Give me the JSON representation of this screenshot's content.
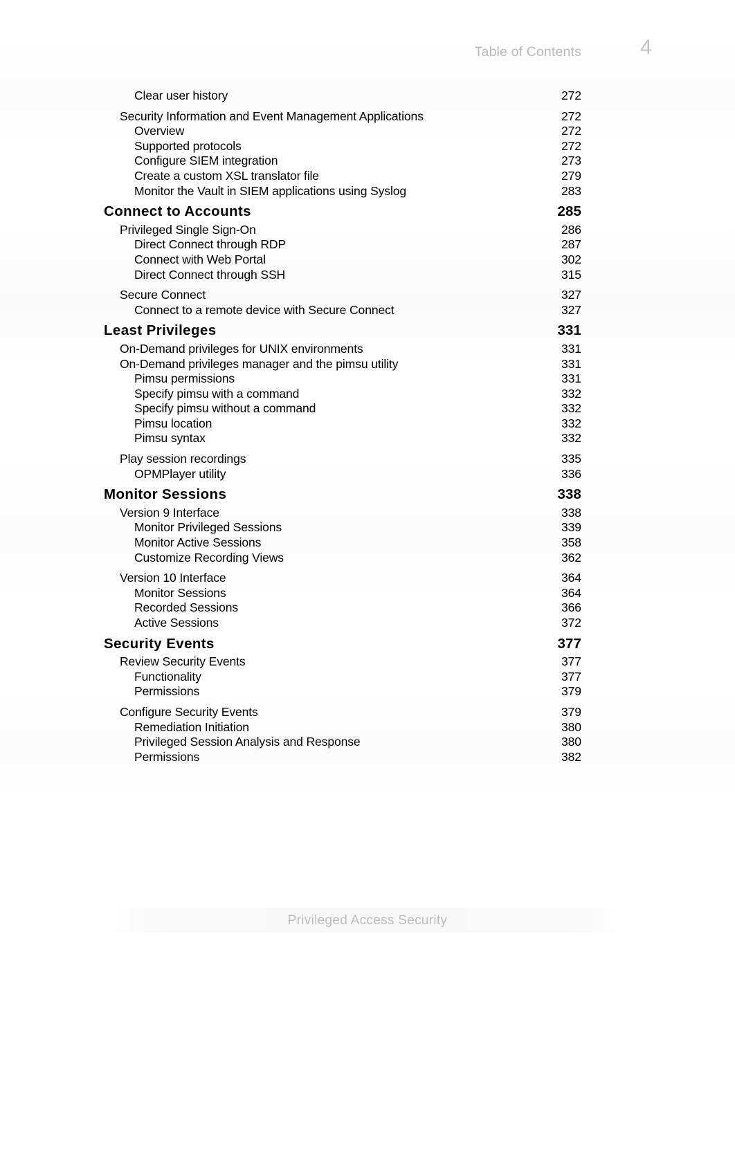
{
  "header": {
    "label": "Table of Contents",
    "page_number": "4"
  },
  "footer": {
    "text": "Privileged Access Security"
  },
  "toc": {
    "entries": [
      {
        "level": 2,
        "title": "Clear user history",
        "page": "272"
      },
      {
        "level": 1,
        "title": "Security Information and Event Management Applications",
        "page": "272"
      },
      {
        "level": 2,
        "title": "Overview",
        "page": "272"
      },
      {
        "level": 2,
        "title": "Supported protocols",
        "page": "272"
      },
      {
        "level": 2,
        "title": "Configure SIEM integration",
        "page": "273"
      },
      {
        "level": 2,
        "title": "Create a custom XSL translator file",
        "page": "279"
      },
      {
        "level": 2,
        "title": "Monitor the Vault in SIEM applications using Syslog",
        "page": "283"
      },
      {
        "level": 0,
        "title": "Connect to Accounts",
        "page": "285"
      },
      {
        "level": 1,
        "title": "Privileged Single Sign-On",
        "page": "286"
      },
      {
        "level": 2,
        "title": "Direct Connect through RDP",
        "page": "287"
      },
      {
        "level": 2,
        "title": "Connect with Web Portal",
        "page": "302"
      },
      {
        "level": 2,
        "title": "Direct Connect through SSH",
        "page": "315"
      },
      {
        "level": 1,
        "title": "Secure Connect",
        "page": "327"
      },
      {
        "level": 2,
        "title": "Connect to a remote device with Secure Connect",
        "page": "327"
      },
      {
        "level": 0,
        "title": "Least Privileges",
        "page": "331"
      },
      {
        "level": 1,
        "title": "On-Demand privileges for UNIX environments",
        "page": "331"
      },
      {
        "level": 1,
        "title": "On-Demand privileges manager and the pimsu utility",
        "page": "331"
      },
      {
        "level": 2,
        "title": "Pimsu permissions",
        "page": "331"
      },
      {
        "level": 2,
        "title": "Specify pimsu with a command",
        "page": "332"
      },
      {
        "level": 2,
        "title": "Specify pimsu without a command",
        "page": "332"
      },
      {
        "level": 2,
        "title": "Pimsu location",
        "page": "332"
      },
      {
        "level": 2,
        "title": "Pimsu syntax",
        "page": "332"
      },
      {
        "level": 1,
        "title": "Play session recordings",
        "page": "335"
      },
      {
        "level": 2,
        "title": "OPMPlayer utility",
        "page": "336"
      },
      {
        "level": 0,
        "title": "Monitor Sessions",
        "page": "338"
      },
      {
        "level": 1,
        "title": "Version 9 Interface",
        "page": "338"
      },
      {
        "level": 2,
        "title": "Monitor Privileged Sessions",
        "page": "339"
      },
      {
        "level": 2,
        "title": "Monitor Active Sessions",
        "page": "358"
      },
      {
        "level": 2,
        "title": "Customize Recording Views",
        "page": "362"
      },
      {
        "level": 1,
        "title": "Version 10 Interface",
        "page": "364"
      },
      {
        "level": 2,
        "title": "Monitor Sessions",
        "page": "364"
      },
      {
        "level": 2,
        "title": "Recorded Sessions",
        "page": "366"
      },
      {
        "level": 2,
        "title": "Active Sessions",
        "page": "372"
      },
      {
        "level": 0,
        "title": "Security Events",
        "page": "377"
      },
      {
        "level": 1,
        "title": "Review Security Events",
        "page": "377"
      },
      {
        "level": 2,
        "title": "Functionality",
        "page": "377"
      },
      {
        "level": 2,
        "title": "Permissions",
        "page": "379"
      },
      {
        "level": 1,
        "title": "Configure Security Events",
        "page": "379"
      },
      {
        "level": 2,
        "title": "Remediation Initiation",
        "page": "380"
      },
      {
        "level": 2,
        "title": "Privileged Session Analysis and Response",
        "page": "380"
      },
      {
        "level": 2,
        "title": "Permissions",
        "page": "382"
      }
    ]
  }
}
